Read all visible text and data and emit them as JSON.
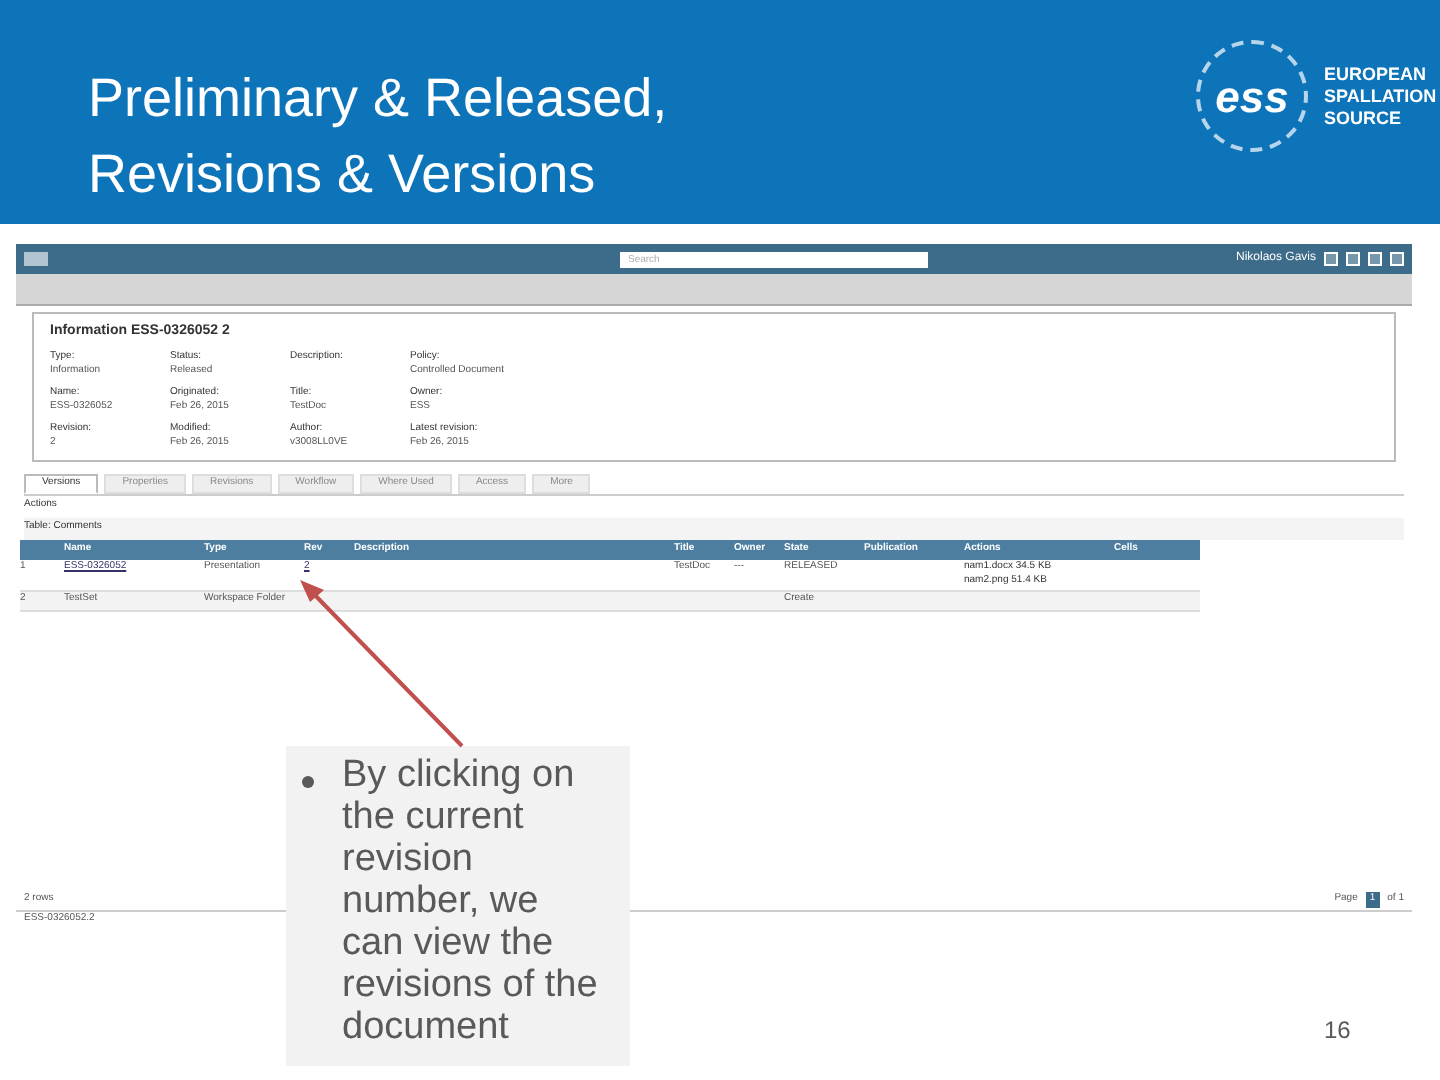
{
  "slide": {
    "title_lines": [
      "Preliminary & Released,",
      "Revisions & Versions"
    ],
    "logo_text": [
      "EUROPEAN",
      "SPALLATION",
      "SOURCE"
    ],
    "logo_mark": "ess",
    "page_number": "16"
  },
  "app": {
    "search": {
      "placeholder": "Search"
    },
    "user": "Nikolaos Gavis",
    "info": {
      "title": "Information ESS-0326052 2",
      "fields": [
        {
          "label": "Type:",
          "value": "Information"
        },
        {
          "label": "Status:",
          "value": "Released"
        },
        {
          "label": "Description:"
        },
        {
          "label": "Policy:",
          "value": "Controlled Document"
        },
        {
          "label": "Name:",
          "value": "ESS-0326052"
        },
        {
          "label": "Originated:",
          "value": "Feb 26, 2015"
        },
        {
          "label": "Title:",
          "value": "TestDoc"
        },
        {
          "label": "Owner:",
          "value": "ESS"
        },
        {
          "label": "Revision:",
          "value": "2"
        },
        {
          "label": "Modified:",
          "value": "Feb 26, 2015"
        },
        {
          "label": "Author:",
          "value": "v3008LL0VE"
        },
        {
          "label": "Latest revision:",
          "value": "Feb 26, 2015"
        }
      ]
    },
    "tabs": [
      {
        "label": "Versions",
        "selected": true
      },
      {
        "label": "Properties",
        "selected": false
      },
      {
        "label": "Revisions",
        "selected": false
      },
      {
        "label": "Workflow",
        "selected": false
      },
      {
        "label": "Where Used",
        "selected": false
      },
      {
        "label": "Access",
        "selected": false
      },
      {
        "label": "More",
        "selected": false
      }
    ],
    "actions_label": "Actions",
    "table_label": "Table: Comments",
    "columns": [
      "Name",
      "Type",
      "Rev",
      "Description",
      "Title",
      "Owner",
      "State",
      "Publication",
      "Actions",
      "Cells"
    ],
    "rows": [
      {
        "index": "1",
        "name": "ESS-0326052",
        "type": "Presentation",
        "rev": "2",
        "title": "TestDoc",
        "owner": "---",
        "state": "RELEASED",
        "files": [
          "nam1.docx 34.5 KB",
          "nam2.png 51.4 KB"
        ],
        "link": true
      },
      {
        "index": "2",
        "name": "TestSet",
        "type": "Workspace Folder",
        "rev": "",
        "title": "",
        "owner": "",
        "state": "Create",
        "files": [],
        "link": false
      }
    ],
    "row_count": "2 rows",
    "footer_item": "ESS-0326052.2",
    "pager": {
      "label": "Page",
      "current": "1",
      "of": "of 1"
    }
  },
  "callout": {
    "text": "By clicking on the current revision number, we can view the revisions of the document"
  }
}
